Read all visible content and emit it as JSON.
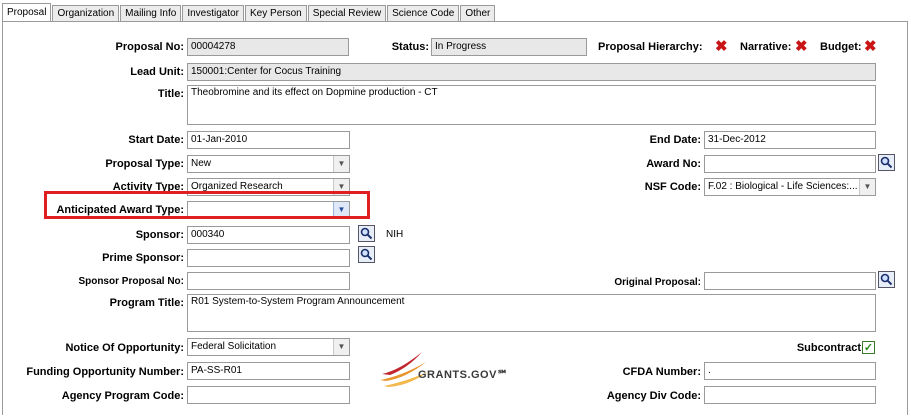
{
  "tabs": [
    "Proposal",
    "Organization",
    "Mailing Info",
    "Investigator",
    "Key Person",
    "Special Review",
    "Science Code",
    "Other"
  ],
  "active_tab": 0,
  "proposal_no": {
    "label": "Proposal No:",
    "value": "00004278"
  },
  "status": {
    "label": "Status:",
    "value": "In Progress"
  },
  "indicators": {
    "hierarchy": "Proposal Hierarchy:",
    "narrative": "Narrative:",
    "budget": "Budget:",
    "mark": "✖"
  },
  "lead_unit": {
    "label": "Lead Unit:",
    "value": "150001:Center for Cocus Training"
  },
  "title": {
    "label": "Title:",
    "value": "Theobromine and its effect on Dopmine production - CT"
  },
  "start_date": {
    "label": "Start Date:",
    "value": "01-Jan-2010"
  },
  "end_date": {
    "label": "End Date:",
    "value": "31-Dec-2012"
  },
  "proposal_type": {
    "label": "Proposal Type:",
    "value": "New"
  },
  "award_no": {
    "label": "Award No:",
    "value": ""
  },
  "activity_type": {
    "label": "Activity Type:",
    "value": "Organized Research"
  },
  "nsf_code": {
    "label": "NSF Code:",
    "value": "F.02 : Biological - Life Sciences:..."
  },
  "anticipated_award_type": {
    "label": "Anticipated Award Type:",
    "value": ""
  },
  "sponsor": {
    "label": "Sponsor:",
    "value": "000340",
    "name": "NIH"
  },
  "prime_sponsor": {
    "label": "Prime Sponsor:",
    "value": ""
  },
  "sponsor_proposal_no": {
    "label": "Sponsor Proposal No:",
    "value": ""
  },
  "original_proposal": {
    "label": "Original Proposal:",
    "value": ""
  },
  "program_title": {
    "label": "Program Title:",
    "value": "R01 System-to-System Program Announcement"
  },
  "notice_of_opportunity": {
    "label": "Notice Of Opportunity:",
    "value": "Federal Solicitation"
  },
  "subcontract": {
    "label": "Subcontract",
    "checked": true,
    "mark": "✓"
  },
  "funding_opportunity_number": {
    "label": "Funding Opportunity Number:",
    "value": "PA-SS-R01"
  },
  "cfda_number": {
    "label": "CFDA Number:",
    "value": "."
  },
  "agency_program_code": {
    "label": "Agency Program Code:",
    "value": ""
  },
  "agency_div_code": {
    "label": "Agency Div Code:",
    "value": ""
  },
  "logo": {
    "text": "GRANTS.GOV℠"
  },
  "colors": {
    "highlight": "#e02020",
    "x_mark": "#c81414",
    "readonly_bg": "#e8e8e8"
  }
}
